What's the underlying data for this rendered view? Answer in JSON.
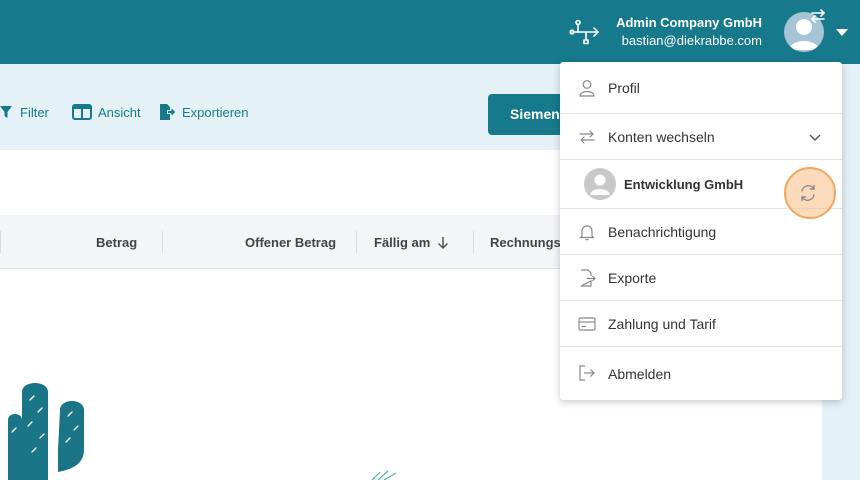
{
  "header": {
    "company": "Admin Company GmbH",
    "email": "bastian@diekrabbe.com",
    "icons": [
      "usb-connection-icon",
      "user-avatar-icon",
      "account-switch-icon",
      "caret-down-icon"
    ]
  },
  "toolbar": {
    "filter": "Filter",
    "view": "Ansicht",
    "export": "Exportieren",
    "primary_button": "Siemens"
  },
  "table": {
    "columns": [
      "Betrag",
      "Offener Betrag",
      "Fällig am",
      "Rechnungsd"
    ],
    "sort_column": "Fällig am",
    "sort_direction": "descending"
  },
  "menu": {
    "items": [
      {
        "label": "Profil",
        "icon": "user-icon"
      },
      {
        "label": "Konten wechseln",
        "icon": "switch-icon"
      },
      {
        "label": "Entwicklung GmbH",
        "icon": "avatar"
      },
      {
        "label": "Benachrichtigung",
        "icon": "bell-icon"
      },
      {
        "label": "Exporte",
        "icon": "file-export-icon"
      },
      {
        "label": "Zahlung und Tarif",
        "icon": "card-icon"
      },
      {
        "label": "Abmelden",
        "icon": "logout-icon"
      }
    ]
  },
  "colors": {
    "primary": "#177a8c",
    "toolbar_bg": "#e4f1f6",
    "highlight": "#f2a660"
  }
}
